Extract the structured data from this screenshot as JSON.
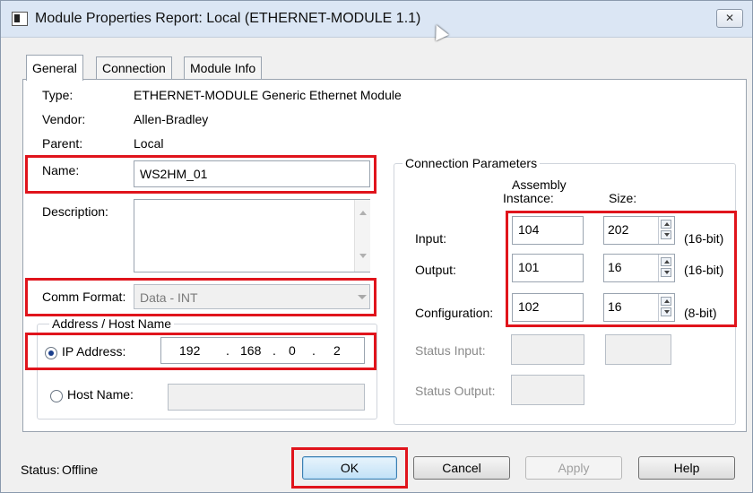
{
  "window": {
    "title": "Module Properties Report: Local (ETHERNET-MODULE 1.1)",
    "close_glyph": "✕"
  },
  "tabs": [
    {
      "label": "General"
    },
    {
      "label": "Connection"
    },
    {
      "label": "Module Info"
    }
  ],
  "general": {
    "type_label": "Type:",
    "type_value": "ETHERNET-MODULE Generic Ethernet Module",
    "vendor_label": "Vendor:",
    "vendor_value": "Allen-Bradley",
    "parent_label": "Parent:",
    "parent_value": "Local",
    "name_label": "Name:",
    "name_value": "WS2HM_01",
    "description_label": "Description:",
    "description_value": "",
    "comm_format_label": "Comm Format:",
    "comm_format_value": "Data - INT",
    "address_group_label": "Address / Host Name",
    "ip_label": "IP Address:",
    "ip_octets": [
      "192",
      "168",
      "0",
      "2"
    ],
    "host_label": "Host Name:",
    "host_value": ""
  },
  "connection": {
    "group_label": "Connection Parameters",
    "col_instance": "Assembly\nInstance:",
    "col_instance_l1": "Assembly",
    "col_instance_l2": "Instance:",
    "col_size": "Size:",
    "rows": [
      {
        "label": "Input:",
        "instance": "104",
        "size": "202",
        "unit": "(16-bit)"
      },
      {
        "label": "Output:",
        "instance": "101",
        "size": "16",
        "unit": "(16-bit)"
      },
      {
        "label": "Configuration:",
        "instance": "102",
        "size": "16",
        "unit": "(8-bit)"
      }
    ],
    "status_input_label": "Status Input:",
    "status_output_label": "Status Output:"
  },
  "footer": {
    "status_label": "Status:",
    "status_value": "Offline",
    "ok": "OK",
    "cancel": "Cancel",
    "apply": "Apply",
    "help": "Help"
  },
  "colors": {
    "highlight": "#e0141c",
    "title_bar": "#dbe6f4",
    "default_button": "#c1e1f7"
  }
}
